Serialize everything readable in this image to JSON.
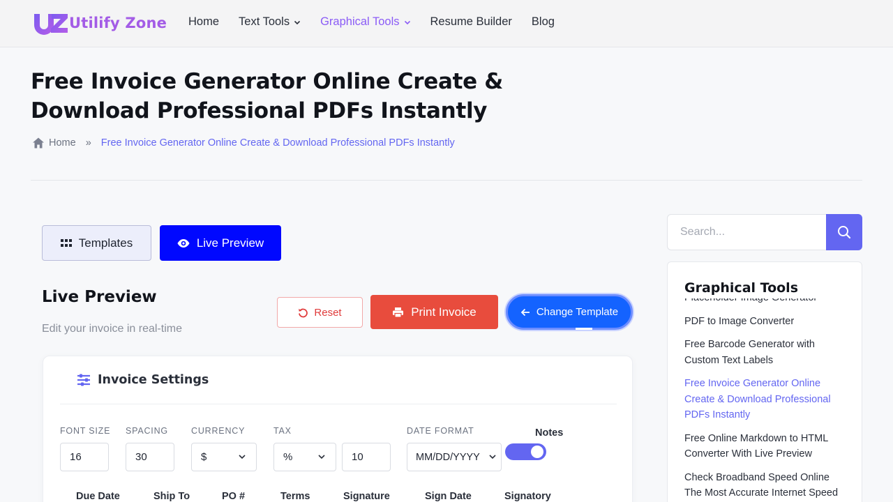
{
  "header": {
    "logo_text": "Utilify Zone",
    "nav": [
      {
        "label": "Home",
        "dropdown": false,
        "active": false
      },
      {
        "label": "Text Tools",
        "dropdown": true,
        "active": false
      },
      {
        "label": "Graphical Tools",
        "dropdown": true,
        "active": true
      },
      {
        "label": "Resume Builder",
        "dropdown": false,
        "active": false
      },
      {
        "label": "Blog",
        "dropdown": false,
        "active": false
      }
    ]
  },
  "page": {
    "title": "Free Invoice Generator Online Create & Download Professional PDFs Instantly",
    "breadcrumb": {
      "home": "Home",
      "separator": "»",
      "current": "Free Invoice Generator Online Create & Download Professional PDFs Instantly"
    }
  },
  "tabs": {
    "templates": "Templates",
    "live_preview": "Live Preview"
  },
  "live_preview": {
    "title": "Live Preview",
    "subtitle": "Edit your invoice in real-time",
    "reset": "Reset",
    "print": "Print Invoice",
    "change_template": "Change Template"
  },
  "settings": {
    "title": "Invoice Settings",
    "font_size": {
      "label": "FONT SIZE",
      "value": "16"
    },
    "spacing": {
      "label": "SPACING",
      "value": "30"
    },
    "currency": {
      "label": "CURRENCY",
      "value": "$"
    },
    "tax": {
      "label": "TAX",
      "type": "%",
      "value": "10"
    },
    "date_format": {
      "label": "DATE FORMAT",
      "value": "MM/DD/YYYY"
    },
    "notes": {
      "label": "Notes",
      "enabled": true
    },
    "columns": [
      "Due Date",
      "Ship To",
      "PO #",
      "Terms",
      "Signature",
      "Sign Date",
      "Signatory"
    ]
  },
  "sidebar": {
    "search_placeholder": "Search...",
    "title": "Graphical Tools",
    "items": [
      {
        "label": "Placeholder Image Generator",
        "active": false
      },
      {
        "label": "PDF to Image Converter",
        "active": false
      },
      {
        "label": "Free Barcode Generator with Custom Text Labels",
        "active": false
      },
      {
        "label": "Free Invoice Generator Online Create & Download Professional PDFs Instantly",
        "active": true
      },
      {
        "label": "Free Online Markdown to HTML Converter With Live Preview",
        "active": false
      },
      {
        "label": "Check Broadband Speed Online The Most Accurate Internet Speed",
        "active": false
      }
    ]
  },
  "colors": {
    "accent": "#6366f1",
    "primary_blue": "#0008ff",
    "danger": "#e84c3d",
    "logo_purple": "#a35ce6"
  }
}
